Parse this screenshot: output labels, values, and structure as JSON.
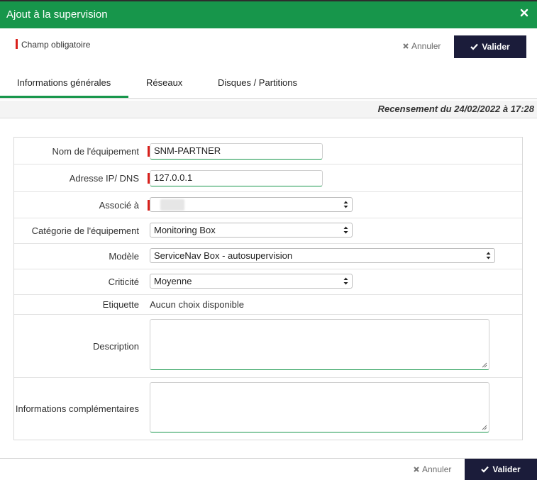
{
  "dialog": {
    "title": "Ajout à la supervision",
    "close_icon": "close-icon",
    "accent_color": "#17964b"
  },
  "legend": {
    "required_label": "Champ obligatoire",
    "required_color": "#d9201b"
  },
  "actions": {
    "cancel_label": "Annuler",
    "validate_label": "Valider",
    "cancel_icon": "x-icon",
    "validate_icon": "check-icon"
  },
  "tabs": [
    {
      "label": "Informations générales",
      "active": true
    },
    {
      "label": "Réseaux",
      "active": false
    },
    {
      "label": "Disques / Partitions",
      "active": false
    }
  ],
  "census": "Recensement du 24/02/2022 à 17:28",
  "form": {
    "device_name": {
      "label": "Nom de l'équipement",
      "value": "SNM-PARTNER",
      "required": true
    },
    "ip_dns": {
      "label": "Adresse IP/ DNS",
      "value": "127.0.0.1",
      "required": true
    },
    "associated": {
      "label": "Associé à",
      "value": "",
      "required": true
    },
    "category": {
      "label": "Catégorie de l'équipement",
      "value": "Monitoring Box"
    },
    "model": {
      "label": "Modèle",
      "value": "ServiceNav Box - autosupervision"
    },
    "criticality": {
      "label": "Criticité",
      "value": "Moyenne"
    },
    "tag": {
      "label": "Etiquette",
      "value": "Aucun choix disponible"
    },
    "description": {
      "label": "Description",
      "value": ""
    },
    "extra_info": {
      "label": "Informations complémentaires",
      "value": ""
    }
  }
}
